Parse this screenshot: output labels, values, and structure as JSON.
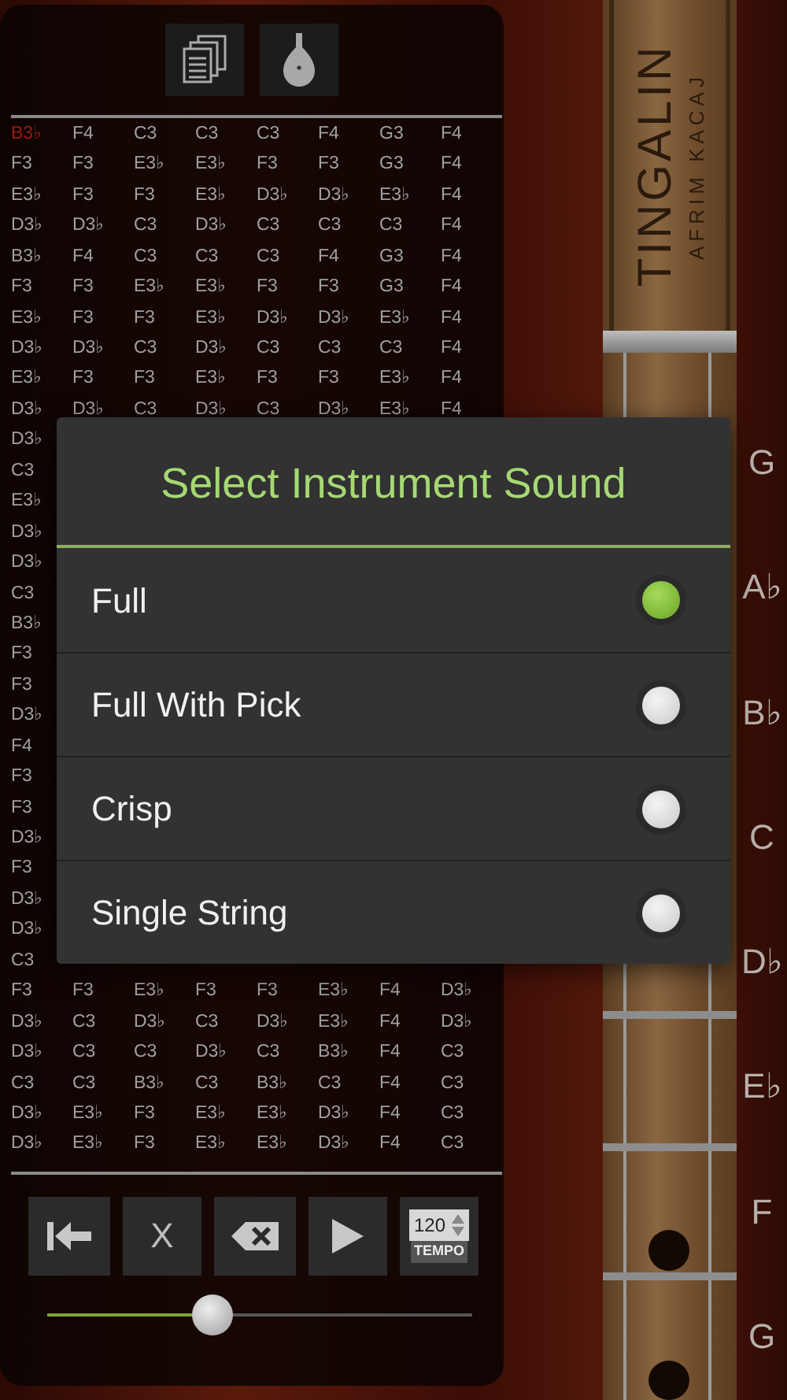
{
  "tab_grid": {
    "rows": [
      {
        "cells": [
          "B3♭",
          "F4",
          "C3",
          "C3",
          "C3",
          "F4",
          "G3",
          "F4"
        ],
        "current": true
      },
      {
        "cells": [
          "F3",
          "F3",
          "E3♭",
          "E3♭",
          "F3",
          "F3",
          "G3",
          "F4"
        ],
        "current": false
      },
      {
        "cells": [
          "E3♭",
          "F3",
          "F3",
          "E3♭",
          "D3♭",
          "D3♭",
          "E3♭",
          "F4"
        ],
        "current": false
      },
      {
        "cells": [
          "D3♭",
          "D3♭",
          "C3",
          "D3♭",
          "C3",
          "C3",
          "C3",
          "F4"
        ],
        "current": false
      },
      {
        "cells": [
          "B3♭",
          "F4",
          "C3",
          "C3",
          "C3",
          "F4",
          "G3",
          "F4"
        ],
        "current": false
      },
      {
        "cells": [
          "F3",
          "F3",
          "E3♭",
          "E3♭",
          "F3",
          "F3",
          "G3",
          "F4"
        ],
        "current": false
      },
      {
        "cells": [
          "E3♭",
          "F3",
          "F3",
          "E3♭",
          "D3♭",
          "D3♭",
          "E3♭",
          "F4"
        ],
        "current": false
      },
      {
        "cells": [
          "D3♭",
          "D3♭",
          "C3",
          "D3♭",
          "C3",
          "C3",
          "C3",
          "F4"
        ],
        "current": false
      },
      {
        "cells": [
          "E3♭",
          "F3",
          "F3",
          "E3♭",
          "F3",
          "F3",
          "E3♭",
          "F4"
        ],
        "current": false
      },
      {
        "cells": [
          "D3♭",
          "D3♭",
          "C3",
          "D3♭",
          "C3",
          "D3♭",
          "E3♭",
          "F4"
        ],
        "current": false
      },
      {
        "cells": [
          "D3♭"
        ],
        "current": false
      },
      {
        "cells": [
          "C3"
        ],
        "current": false
      },
      {
        "cells": [
          "E3♭"
        ],
        "current": false
      },
      {
        "cells": [
          "D3♭"
        ],
        "current": false
      },
      {
        "cells": [
          "D3♭"
        ],
        "current": false
      },
      {
        "cells": [
          "C3"
        ],
        "current": false
      },
      {
        "cells": [
          "B3♭"
        ],
        "current": false
      },
      {
        "cells": [
          "F3"
        ],
        "current": false
      },
      {
        "cells": [
          "F3"
        ],
        "current": false
      },
      {
        "cells": [
          "D3♭"
        ],
        "current": false
      },
      {
        "cells": [
          "F4"
        ],
        "current": false
      },
      {
        "cells": [
          "F3"
        ],
        "current": false
      },
      {
        "cells": [
          "F3"
        ],
        "current": false
      },
      {
        "cells": [
          "D3♭"
        ],
        "current": false
      },
      {
        "cells": [
          "F3"
        ],
        "current": false
      },
      {
        "cells": [
          "D3♭"
        ],
        "current": false
      },
      {
        "cells": [
          "D3♭"
        ],
        "current": false
      },
      {
        "cells": [
          "C3"
        ],
        "current": false
      },
      {
        "cells": [
          "F3",
          "F3",
          "E3♭",
          "F3",
          "F3",
          "E3♭",
          "F4",
          "D3♭"
        ],
        "current": false
      },
      {
        "cells": [
          "D3♭",
          "C3",
          "D3♭",
          "C3",
          "D3♭",
          "E3♭",
          "F4",
          "D3♭"
        ],
        "current": false
      },
      {
        "cells": [
          "D3♭",
          "C3",
          "C3",
          "D3♭",
          "C3",
          "B3♭",
          "F4",
          "C3"
        ],
        "current": false
      },
      {
        "cells": [
          "C3",
          "C3",
          "B3♭",
          "C3",
          "B3♭",
          "C3",
          "F4",
          "C3"
        ],
        "current": false
      },
      {
        "cells": [
          "D3♭",
          "E3♭",
          "F3",
          "E3♭",
          "E3♭",
          "D3♭",
          "F4",
          "C3"
        ],
        "current": false
      },
      {
        "cells": [
          "D3♭",
          "E3♭",
          "F3",
          "E3♭",
          "E3♭",
          "D3♭",
          "F4",
          "C3"
        ],
        "current": false
      }
    ]
  },
  "controls": {
    "clear_label": "X",
    "tempo": {
      "value": "120",
      "label": "TEMPO"
    }
  },
  "volume_slider": {
    "level": 0.39
  },
  "headstock": {
    "brand": "TINGALIN",
    "maker": "AFRIM KACAJ"
  },
  "note_labels": [
    "G",
    "A♭",
    "B♭",
    "C",
    "D♭",
    "E♭",
    "F",
    "G"
  ],
  "dialog": {
    "title": "Select Instrument Sound",
    "options": [
      {
        "label": "Full",
        "selected": true
      },
      {
        "label": "Full With Pick",
        "selected": false
      },
      {
        "label": "Crisp",
        "selected": false
      },
      {
        "label": "Single String",
        "selected": false
      }
    ]
  }
}
